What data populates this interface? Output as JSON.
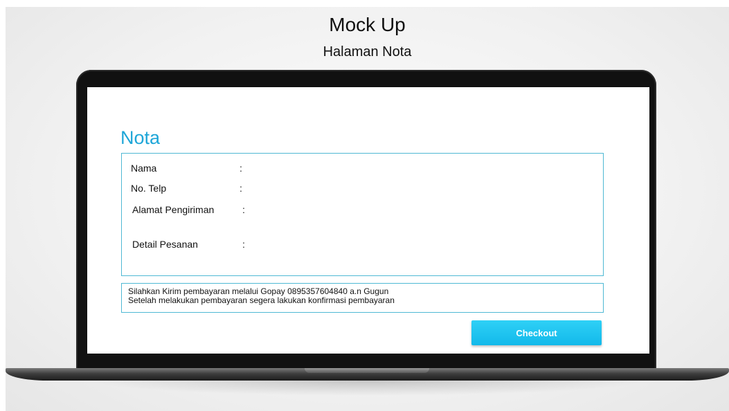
{
  "mockup": {
    "title": "Mock Up",
    "subtitle": "Halaman Nota"
  },
  "nota": {
    "heading": "Nota",
    "fields": [
      {
        "label": "Nama",
        "colon": ":"
      },
      {
        "label": "No. Telp",
        "colon": ":"
      },
      {
        "label": "Alamat Pengiriman",
        "colon": ":"
      },
      {
        "label": "Detail Pesanan",
        "colon": ":"
      }
    ],
    "payment": {
      "line1": "Silahkan Kirim pembayaran melalui Gopay  0895357604840 a.n  Gugun",
      "line2": "Setelah melakukan pembayaran segera lakukan konfirmasi pembayaran"
    },
    "checkout_label": "Checkout"
  },
  "colors": {
    "accent": "#1ea6d8",
    "border": "#4fb9d4",
    "button": "#12b9ea"
  }
}
